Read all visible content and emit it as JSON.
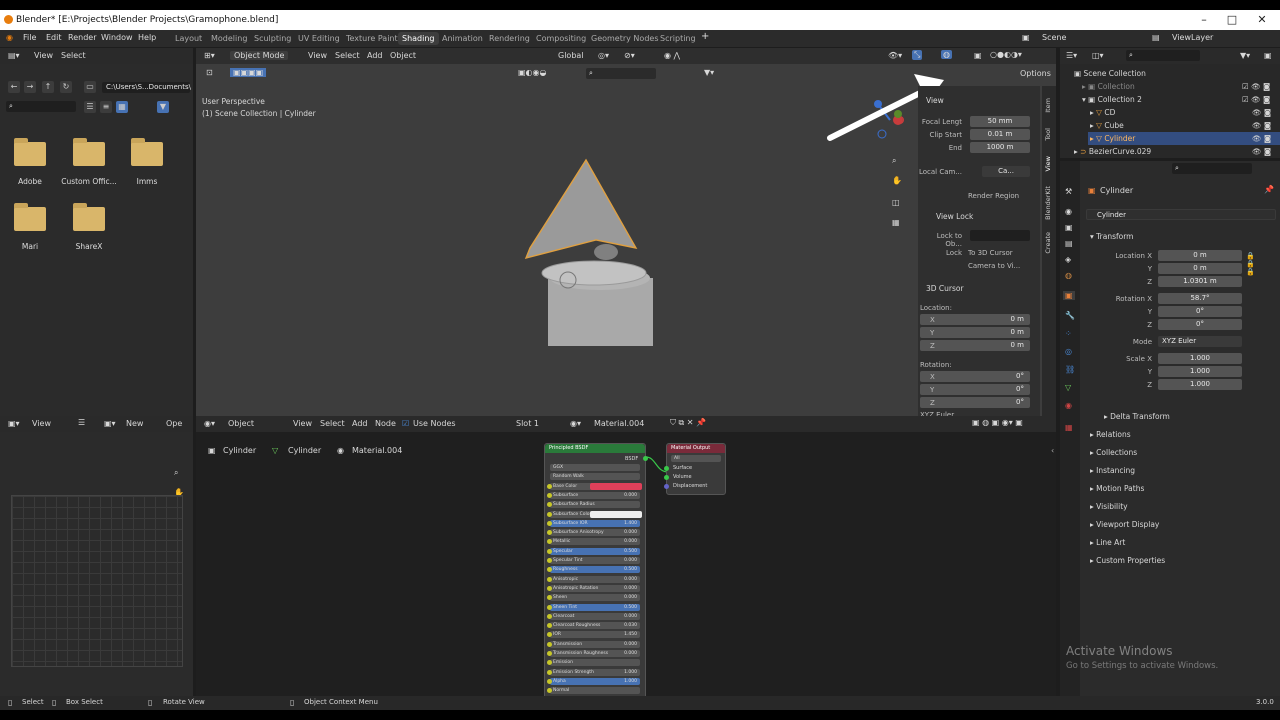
{
  "window": {
    "title": "Blender* [E:\\Projects\\Blender Projects\\Gramophone.blend]"
  },
  "menus": [
    "File",
    "Edit",
    "Render",
    "Window",
    "Help"
  ],
  "workspaces": [
    "Layout",
    "Modeling",
    "Sculpting",
    "UV Editing",
    "Texture Paint",
    "Shading",
    "Animation",
    "Rendering",
    "Compositing",
    "Geometry Nodes",
    "Scripting"
  ],
  "active_workspace": "Shading",
  "scene": {
    "name": "Scene",
    "view_layer": "ViewLayer"
  },
  "filebrowser": {
    "view": "View",
    "select": "Select",
    "path": "C:\\Users\\S...Documents\\",
    "folders": [
      "Adobe",
      "Custom Offic...",
      "Imms",
      "Mari",
      "ShareX"
    ]
  },
  "viewport": {
    "mode": "Object Mode",
    "menus": [
      "View",
      "Select",
      "Add",
      "Object"
    ],
    "orientation": "Global",
    "options": "Options",
    "persp": "User Perspective",
    "collection": "(1) Scene Collection | Cylinder"
  },
  "npanel": {
    "view_title": "View",
    "focal_label": "Focal Lengt",
    "focal": "50 mm",
    "clip_start_label": "Clip Start",
    "clip_start": "0.01 m",
    "end_label": "End",
    "end": "1000 m",
    "local_cam_label": "Local Cam...",
    "local_cam": "Ca...",
    "render_region": "Render Region",
    "view_lock": "View Lock",
    "lock_to_label": "Lock to Ob...",
    "lock_label": "Lock",
    "to_3d_cursor": "To 3D Cursor",
    "camera_to_view": "Camera to Vi...",
    "cursor_title": "3D Cursor",
    "location_label": "Location:",
    "rotation_label": "Rotation:",
    "x": "X",
    "y": "Y",
    "z": "Z",
    "loc": [
      "0 m",
      "0 m",
      "0 m"
    ],
    "rot": [
      "0°",
      "0°",
      "0°"
    ],
    "xyz_euler": "XYZ Euler",
    "tabs": [
      "Item",
      "Tool",
      "View",
      "BlenderKit",
      "Create"
    ]
  },
  "image_editor": {
    "view": "View",
    "new": "New",
    "open": "Ope"
  },
  "node_editor": {
    "type": "Object",
    "menus": [
      "View",
      "Select",
      "Add",
      "Node"
    ],
    "use_nodes": "Use Nodes",
    "slot": "Slot 1",
    "material": "Material.004",
    "breadcrumb": [
      "Cylinder",
      "Cylinder",
      "Material.004"
    ]
  },
  "principled": {
    "title": "Principled BSDF",
    "out": "BSDF",
    "rows": [
      {
        "t": "GGX",
        "v": ""
      },
      {
        "t": "Random Walk",
        "v": ""
      },
      {
        "t": "Base Color",
        "v": ""
      },
      {
        "t": "Subsurface",
        "v": "0.000"
      },
      {
        "t": "Subsurface Radius",
        "v": ""
      },
      {
        "t": "Subsurface Color",
        "v": ""
      },
      {
        "t": "Subsurface IOR",
        "v": "1.400"
      },
      {
        "t": "Subsurface Anisotropy",
        "v": "0.000"
      },
      {
        "t": "Metallic",
        "v": "0.000"
      },
      {
        "t": "Specular",
        "v": "0.500"
      },
      {
        "t": "Specular Tint",
        "v": "0.000"
      },
      {
        "t": "Roughness",
        "v": "0.500"
      },
      {
        "t": "Anisotropic",
        "v": "0.000"
      },
      {
        "t": "Anisotropic Rotation",
        "v": "0.000"
      },
      {
        "t": "Sheen",
        "v": "0.000"
      },
      {
        "t": "Sheen Tint",
        "v": "0.500"
      },
      {
        "t": "Clearcoat",
        "v": "0.000"
      },
      {
        "t": "Clearcoat Roughness",
        "v": "0.030"
      },
      {
        "t": "IOR",
        "v": "1.450"
      },
      {
        "t": "Transmission",
        "v": "0.000"
      },
      {
        "t": "Transmission Roughness",
        "v": "0.000"
      },
      {
        "t": "Emission",
        "v": ""
      },
      {
        "t": "Emission Strength",
        "v": "1.000"
      },
      {
        "t": "Alpha",
        "v": "1.000"
      },
      {
        "t": "Normal",
        "v": ""
      }
    ]
  },
  "matout": {
    "title": "Material Output",
    "target": "All",
    "rows": [
      "Surface",
      "Volume",
      "Displacement"
    ]
  },
  "outliner": {
    "items": [
      "Scene Collection",
      "Collection",
      "Collection 2",
      "CD",
      "Cube",
      "Cylinder",
      "BezierCurve.029"
    ]
  },
  "properties": {
    "object": "Cylinder",
    "data": "Cylinder",
    "transform": "Transform",
    "loc_x_label": "Location X",
    "rot_x_label": "Rotation X",
    "mode_label": "Mode",
    "scale_x_label": "Scale X",
    "y": "Y",
    "z": "Z",
    "location": [
      "0 m",
      "0 m",
      "1.0301 m"
    ],
    "rotation": [
      "58.7°",
      "0°",
      "0°"
    ],
    "mode": "XYZ Euler",
    "scale": [
      "1.000",
      "1.000",
      "1.000"
    ],
    "sections": [
      "Delta Transform",
      "Relations",
      "Collections",
      "Instancing",
      "Motion Paths",
      "Visibility",
      "Viewport Display",
      "Line Art",
      "Custom Properties"
    ]
  },
  "statusbar": {
    "select": "Select",
    "box_select": "Box Select",
    "rotate": "Rotate View",
    "context": "Object Context Menu",
    "version": "3.0.0"
  },
  "watermark": {
    "title": "Activate Windows",
    "subtitle": "Go to Settings to activate Windows."
  }
}
